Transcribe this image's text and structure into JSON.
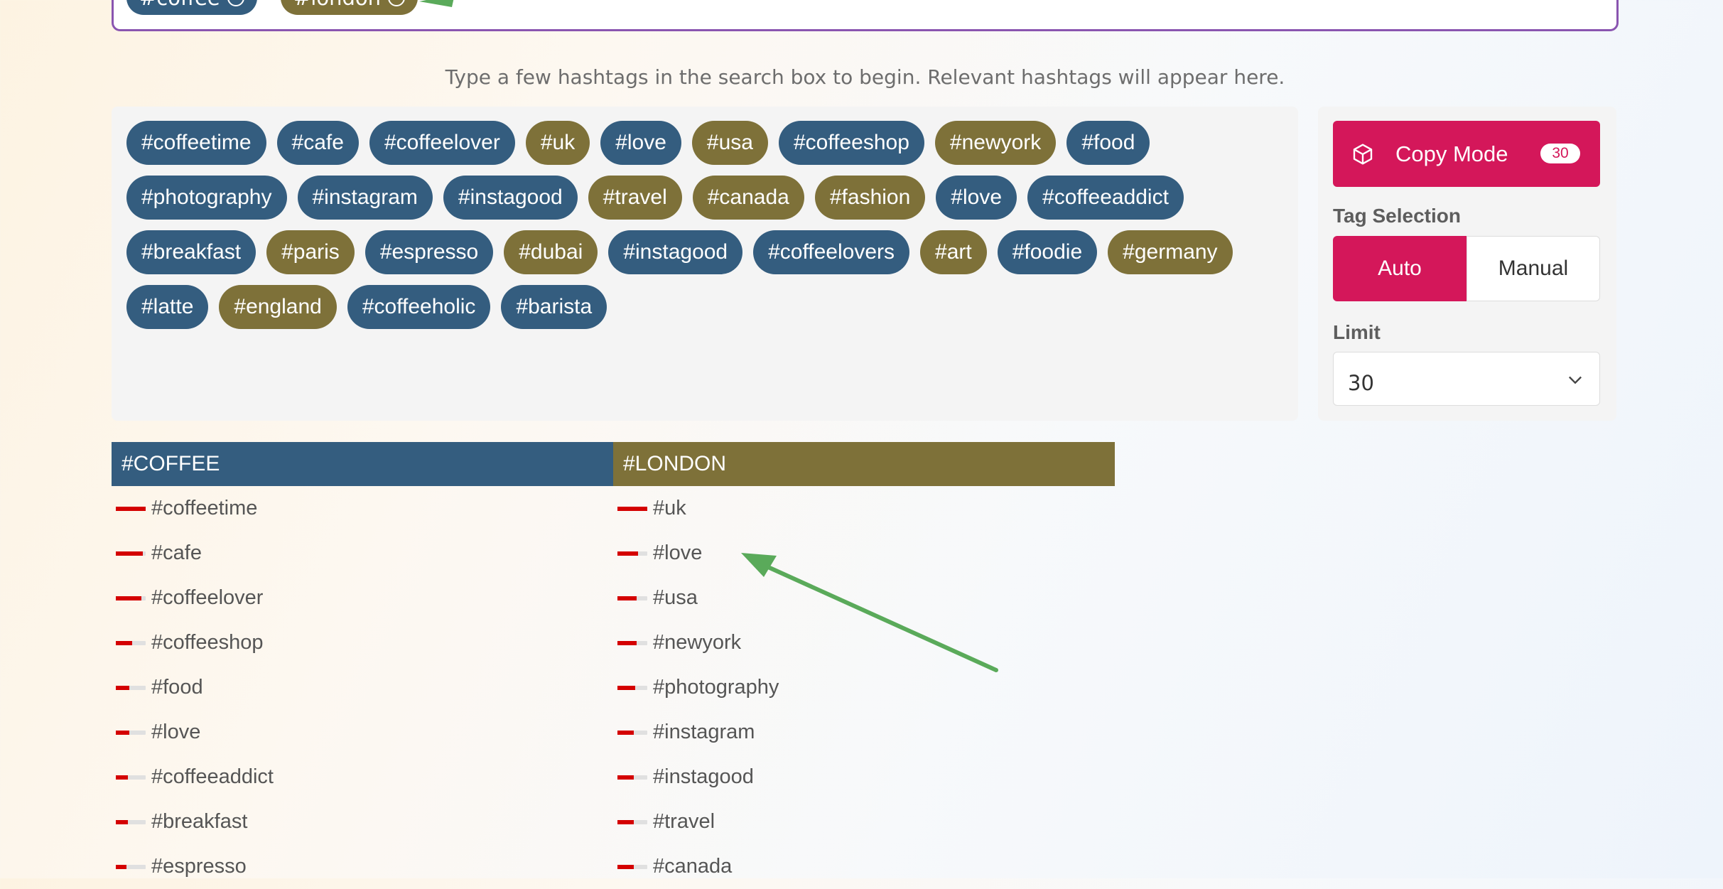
{
  "search": {
    "chips": [
      {
        "label": "#coffee",
        "color": "#345d7f"
      },
      {
        "label": "#london",
        "color": "#7e7139"
      }
    ]
  },
  "hint": "Type a few hashtags in the search box to begin. Relevant hashtags will appear here.",
  "tags": [
    {
      "label": "#coffeetime",
      "group": "blue"
    },
    {
      "label": "#cafe",
      "group": "blue"
    },
    {
      "label": "#coffeelover",
      "group": "blue"
    },
    {
      "label": "#uk",
      "group": "olive"
    },
    {
      "label": "#love",
      "group": "blue"
    },
    {
      "label": "#usa",
      "group": "olive"
    },
    {
      "label": "#coffeeshop",
      "group": "blue"
    },
    {
      "label": "#newyork",
      "group": "olive"
    },
    {
      "label": "#food",
      "group": "blue"
    },
    {
      "label": "#photography",
      "group": "blue"
    },
    {
      "label": "#instagram",
      "group": "blue"
    },
    {
      "label": "#instagood",
      "group": "blue"
    },
    {
      "label": "#travel",
      "group": "olive"
    },
    {
      "label": "#canada",
      "group": "olive"
    },
    {
      "label": "#fashion",
      "group": "olive"
    },
    {
      "label": "#love",
      "group": "blue"
    },
    {
      "label": "#coffeeaddict",
      "group": "blue"
    },
    {
      "label": "#breakfast",
      "group": "blue"
    },
    {
      "label": "#paris",
      "group": "olive"
    },
    {
      "label": "#espresso",
      "group": "blue"
    },
    {
      "label": "#dubai",
      "group": "olive"
    },
    {
      "label": "#instagood",
      "group": "blue"
    },
    {
      "label": "#coffeelovers",
      "group": "blue"
    },
    {
      "label": "#art",
      "group": "olive"
    },
    {
      "label": "#foodie",
      "group": "blue"
    },
    {
      "label": "#germany",
      "group": "olive"
    },
    {
      "label": "#latte",
      "group": "blue"
    },
    {
      "label": "#england",
      "group": "olive"
    },
    {
      "label": "#coffeeholic",
      "group": "blue"
    },
    {
      "label": "#barista",
      "group": "blue"
    }
  ],
  "side": {
    "copy_label": "Copy Mode",
    "copy_count": "30",
    "tag_selection_label": "Tag Selection",
    "auto_label": "Auto",
    "manual_label": "Manual",
    "limit_label": "Limit",
    "limit_value": "30"
  },
  "columns": [
    {
      "header": "#COFFEE",
      "color": "#345d7f",
      "items": [
        {
          "label": "#coffeetime",
          "strength": 1.0
        },
        {
          "label": "#cafe",
          "strength": 0.9
        },
        {
          "label": "#coffeelover",
          "strength": 0.85
        },
        {
          "label": "#coffeeshop",
          "strength": 0.55
        },
        {
          "label": "#food",
          "strength": 0.45
        },
        {
          "label": "#love",
          "strength": 0.45
        },
        {
          "label": "#coffeeaddict",
          "strength": 0.4
        },
        {
          "label": "#breakfast",
          "strength": 0.4
        },
        {
          "label": "#espresso",
          "strength": 0.35
        }
      ]
    },
    {
      "header": "#LONDON",
      "color": "#7e7139",
      "items": [
        {
          "label": "#uk",
          "strength": 1.0
        },
        {
          "label": "#love",
          "strength": 0.7
        },
        {
          "label": "#usa",
          "strength": 0.65
        },
        {
          "label": "#newyork",
          "strength": 0.65
        },
        {
          "label": "#photography",
          "strength": 0.6
        },
        {
          "label": "#instagram",
          "strength": 0.55
        },
        {
          "label": "#instagood",
          "strength": 0.55
        },
        {
          "label": "#travel",
          "strength": 0.55
        },
        {
          "label": "#canada",
          "strength": 0.55
        }
      ]
    }
  ],
  "colors": {
    "accent": "#d4175a",
    "blue_tag": "#345d7f",
    "olive_tag": "#7e7139",
    "annotation_arrow": "#5aaa5a",
    "bar_fill": "#d40000"
  }
}
